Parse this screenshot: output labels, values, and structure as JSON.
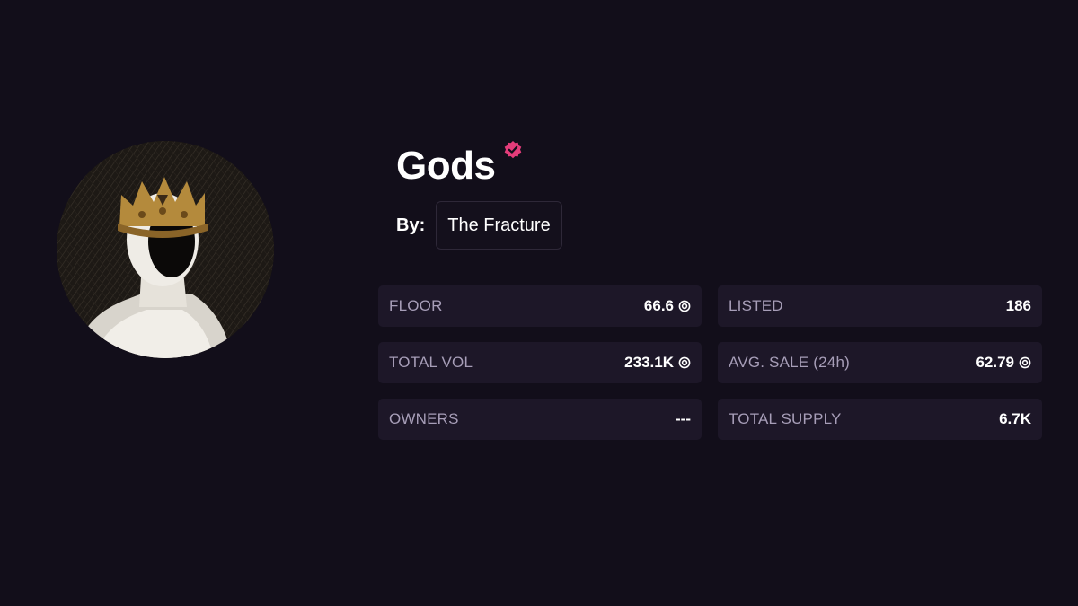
{
  "collection": {
    "name": "Gods",
    "verified_icon": "verified-badge-icon",
    "accent_color": "#e43c7a",
    "by_label": "By:",
    "creator": "The Fracture"
  },
  "stats": [
    {
      "label": "FLOOR",
      "value": "66.6",
      "coin": true
    },
    {
      "label": "LISTED",
      "value": "186",
      "coin": false
    },
    {
      "label": "TOTAL VOL",
      "value": "233.1K",
      "coin": true
    },
    {
      "label": "AVG. SALE (24h)",
      "value": "62.79",
      "coin": true
    },
    {
      "label": "OWNERS",
      "value": "---",
      "coin": false
    },
    {
      "label": "TOTAL SUPPLY",
      "value": "6.7K",
      "coin": false
    }
  ],
  "colors": {
    "background": "#120e1a",
    "card": "#1d1728",
    "label": "#a79eb8"
  }
}
